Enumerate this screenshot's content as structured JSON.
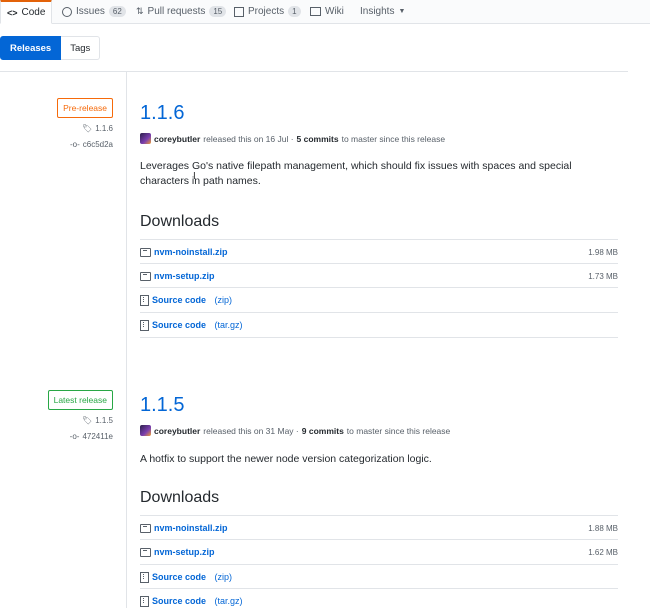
{
  "repo_nav": {
    "tabs": [
      {
        "label": "Code",
        "selected": true,
        "icon": "code-icon"
      },
      {
        "label": "Issues",
        "counter": "62",
        "icon": "issue-icon"
      },
      {
        "label": "Pull requests",
        "counter": "15",
        "icon": "pull-request-icon"
      },
      {
        "label": "Projects",
        "counter": "1",
        "icon": "project-icon"
      },
      {
        "label": "Wiki",
        "icon": "book-icon"
      },
      {
        "label": "Insights",
        "icon": "caret-down-icon"
      }
    ]
  },
  "subnav": {
    "releases": "Releases",
    "tags": "Tags"
  },
  "releases": [
    {
      "label": "Pre-release",
      "tag": "1.1.6",
      "commit": "c6c5d2a",
      "title": "1.1.6",
      "author": "coreybutler",
      "released_text": "released this on 16 Jul ·",
      "commits": "5 commits",
      "commits_suffix": "to master since this release",
      "description": "Leverages Go's native filepath management, which should fix issues with spaces and special characters in path names.",
      "downloads_heading": "Downloads",
      "assets": [
        {
          "name": "nvm-noinstall.zip",
          "size": "1.98 MB"
        },
        {
          "name": "nvm-setup.zip",
          "size": "1.73 MB"
        },
        {
          "name": "Source code",
          "suffix": "(zip)"
        },
        {
          "name": "Source code",
          "suffix": "(tar.gz)"
        }
      ]
    },
    {
      "label": "Latest release",
      "tag": "1.1.5",
      "commit": "472411e",
      "title": "1.1.5",
      "author": "coreybutler",
      "released_text": "released this on 31 May ·",
      "commits": "9 commits",
      "commits_suffix": "to master since this release",
      "description": "A hotfix to support the newer node version categorization logic.",
      "downloads_heading": "Downloads",
      "assets": [
        {
          "name": "nvm-noinstall.zip",
          "size": "1.88 MB"
        },
        {
          "name": "nvm-setup.zip",
          "size": "1.62 MB"
        },
        {
          "name": "Source code",
          "suffix": "(zip)"
        },
        {
          "name": "Source code",
          "suffix": "(tar.gz)"
        }
      ]
    }
  ],
  "colors": {
    "accent": "#0366d6",
    "pre_release": "#f66a0a",
    "latest": "#28a745",
    "selected_tab": "#e36209"
  }
}
